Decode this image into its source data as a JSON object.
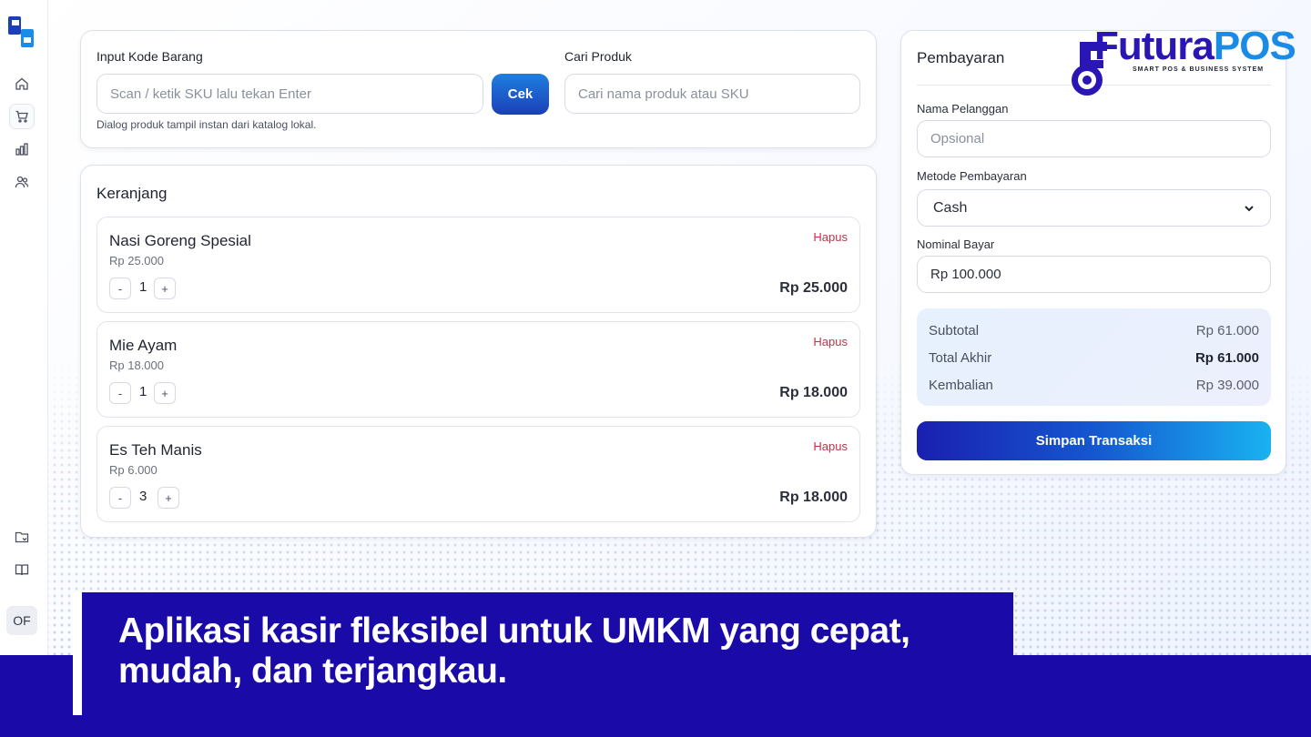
{
  "sidebar": {
    "items": [
      {
        "icon": "home-icon"
      },
      {
        "icon": "cart-icon",
        "active": true
      },
      {
        "icon": "chart-icon"
      },
      {
        "icon": "users-icon"
      }
    ],
    "bottom_icons": [
      "folder-icon",
      "book-icon"
    ],
    "user_initials": "OF"
  },
  "input_card": {
    "code_label": "Input Kode Barang",
    "code_placeholder": "Scan / ketik SKU lalu tekan Enter",
    "check_button": "Cek",
    "hint": "Dialog produk tampil instan dari katalog lokal.",
    "search_label": "Cari Produk",
    "search_placeholder": "Cari nama produk atau SKU"
  },
  "cart": {
    "title": "Keranjang",
    "delete_label": "Hapus",
    "items": [
      {
        "name": "Nasi Goreng Spesial",
        "price": "Rp 25.000",
        "qty": "1",
        "total": "Rp 25.000"
      },
      {
        "name": "Mie Ayam",
        "price": "Rp 18.000",
        "qty": "1",
        "total": "Rp 18.000"
      },
      {
        "name": "Es Teh Manis",
        "price": "Rp 6.000",
        "qty": "3",
        "total": "Rp 18.000"
      }
    ]
  },
  "payment": {
    "title": "Pembayaran",
    "customer_label": "Nama Pelanggan",
    "customer_placeholder": "Opsional",
    "method_label": "Metode Pembayaran",
    "method_value": "Cash",
    "amount_label": "Nominal Bayar",
    "amount_value": "Rp 100.000",
    "subtotal_label": "Subtotal",
    "subtotal_value": "Rp 61.000",
    "total_label": "Total Akhir",
    "total_value": "Rp 61.000",
    "change_label": "Kembalian",
    "change_value": "Rp 39.000",
    "save_button": "Simpan Transaksi"
  },
  "brand": {
    "name_part1": "Futura",
    "name_part2": "POS",
    "tagline": "SMART POS & BUSINESS SYSTEM"
  },
  "banner": {
    "line1": "Aplikasi kasir fleksibel untuk UMKM yang cepat,",
    "line2": "mudah, dan terjangkau."
  },
  "colors": {
    "accent": "#1a0aa8",
    "button_blue": "#1b3fb8",
    "delete_red": "#c0334a"
  }
}
